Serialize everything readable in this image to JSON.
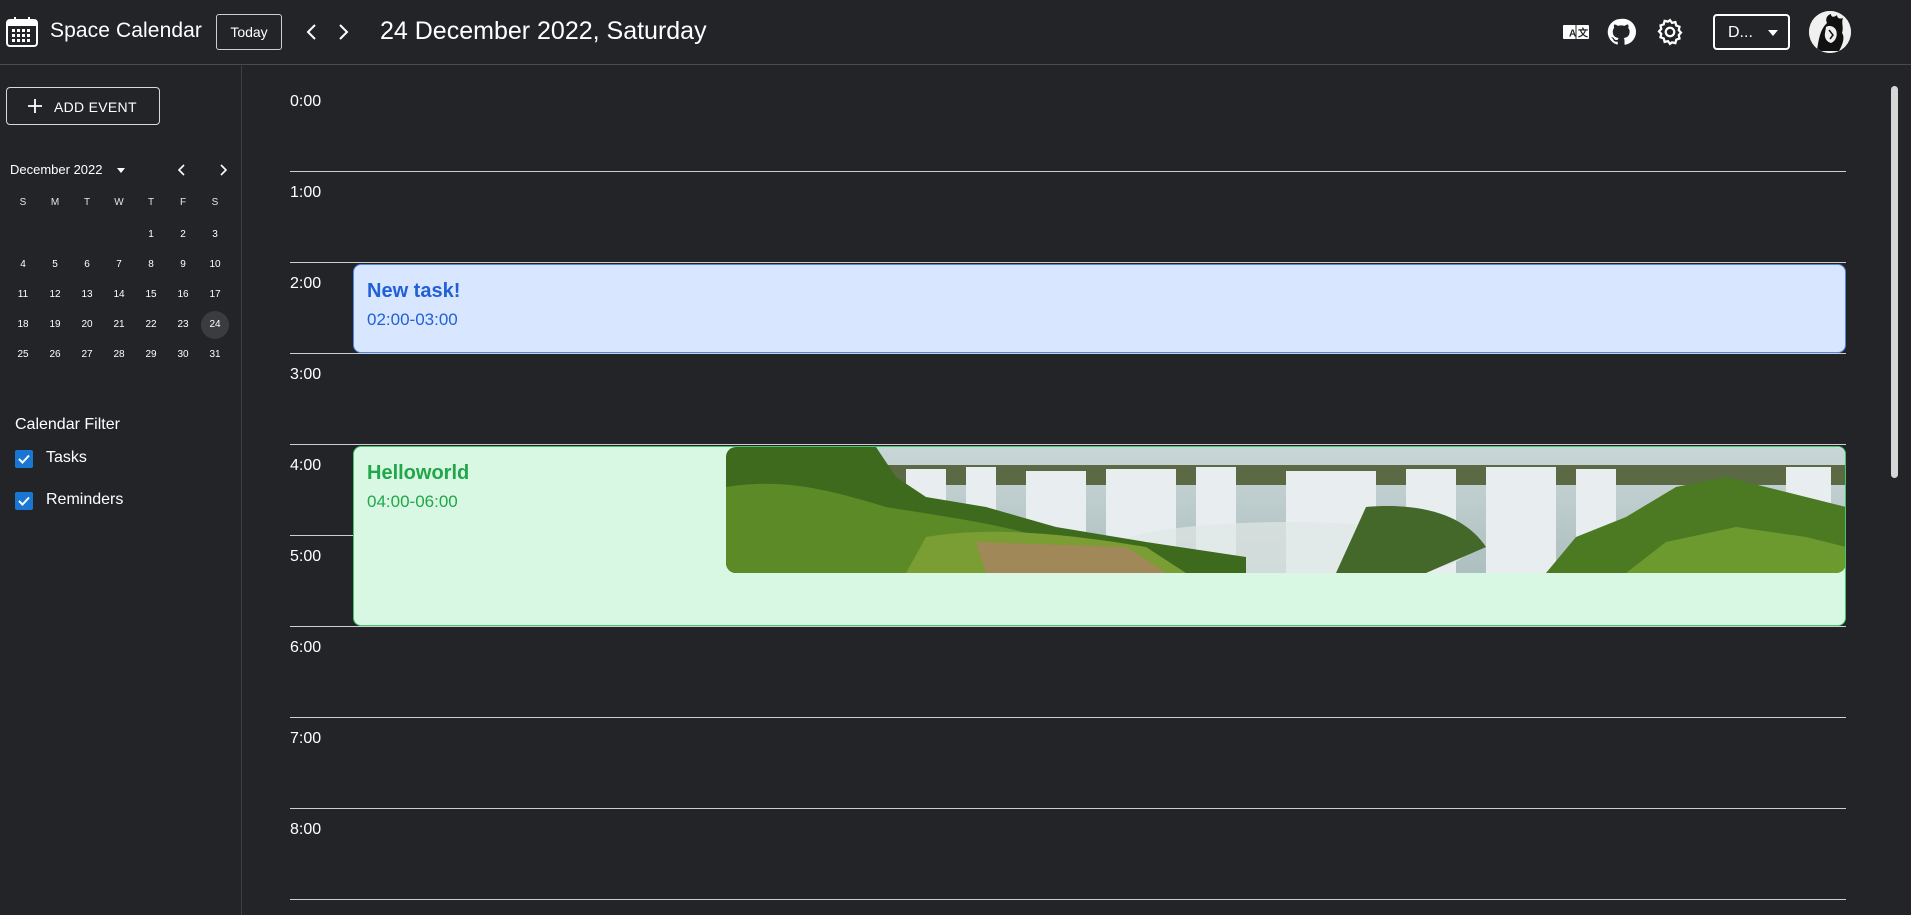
{
  "header": {
    "app_title": "Space Calendar",
    "today_label": "Today",
    "date_title": "24 December 2022, Saturday",
    "view_select_value": "D...",
    "icons": [
      "calendar-icon",
      "chevron-left-icon",
      "chevron-right-icon",
      "translate-icon",
      "github-icon",
      "gear-icon"
    ]
  },
  "sidebar": {
    "add_event_label": "ADD EVENT",
    "mini_calendar": {
      "month_label": "December 2022",
      "weekdays": [
        "S",
        "M",
        "T",
        "W",
        "T",
        "F",
        "S"
      ],
      "weeks": [
        [
          "",
          "",
          "",
          "",
          "1",
          "2",
          "3"
        ],
        [
          "4",
          "5",
          "6",
          "7",
          "8",
          "9",
          "10"
        ],
        [
          "11",
          "12",
          "13",
          "14",
          "15",
          "16",
          "17"
        ],
        [
          "18",
          "19",
          "20",
          "21",
          "22",
          "23",
          "24"
        ],
        [
          "25",
          "26",
          "27",
          "28",
          "29",
          "30",
          "31"
        ]
      ],
      "selected_day": "24"
    },
    "filter": {
      "title": "Calendar Filter",
      "items": [
        {
          "label": "Tasks",
          "checked": true
        },
        {
          "label": "Reminders",
          "checked": true
        }
      ]
    }
  },
  "timeline": {
    "hours": [
      "0:00",
      "1:00",
      "2:00",
      "3:00",
      "4:00",
      "5:00",
      "6:00",
      "7:00",
      "8:00"
    ],
    "events": [
      {
        "title": "New task!",
        "time": "02:00-03:00",
        "color": "#2160d6",
        "background": "#d8e7ff"
      },
      {
        "title": "Helloworld",
        "time": "04:00-06:00",
        "color": "#21a64a",
        "background": "#d9f8e3",
        "image": "waterfall-landscape"
      }
    ]
  },
  "colors": {
    "background": "#232427",
    "accent": "#1976d2"
  }
}
